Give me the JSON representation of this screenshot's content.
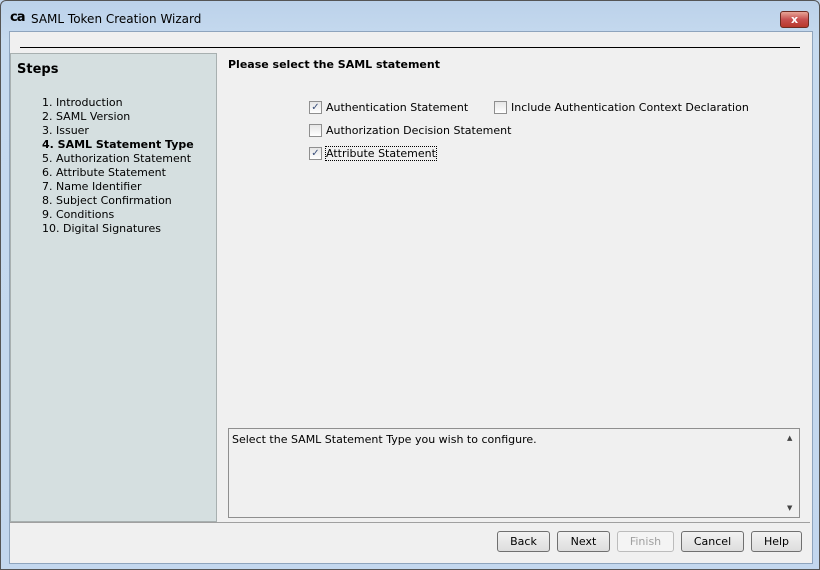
{
  "window": {
    "title": "SAML Token Creation Wizard",
    "logo": "ca",
    "close": "x"
  },
  "steps": {
    "title": "Steps",
    "items": [
      "1. Introduction",
      "2. SAML Version",
      "3. Issuer",
      "4. SAML Statement Type",
      "5. Authorization Statement",
      "6. Attribute Statement",
      "7. Name Identifier",
      "8. Subject Confirmation",
      "9. Conditions",
      "10. Digital Signatures"
    ],
    "current": 3
  },
  "main": {
    "heading": "Please select the SAML statement",
    "options": [
      {
        "label": "Authentication Statement",
        "checked": true
      },
      {
        "label": "Include Authentication Context Declaration",
        "checked": false
      },
      {
        "label": "Authorization Decision Statement",
        "checked": false
      },
      {
        "label": "Attribute Statement",
        "checked": true
      }
    ],
    "description": "Select the SAML Statement Type you wish to configure."
  },
  "buttons": {
    "back": "Back",
    "next": "Next",
    "finish": "Finish",
    "cancel": "Cancel",
    "help": "Help"
  },
  "icons": {
    "check": "✓",
    "up": "▲",
    "down": "▼"
  }
}
